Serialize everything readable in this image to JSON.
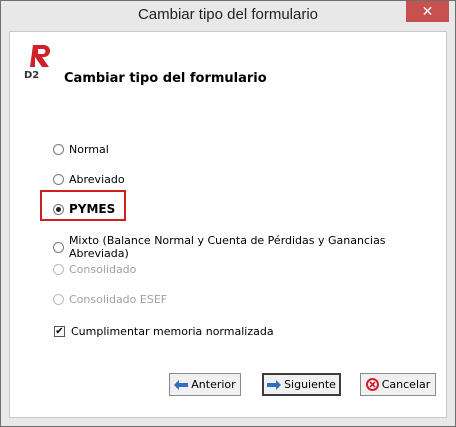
{
  "window": {
    "title": "Cambiar tipo del formulario",
    "close_glyph": "✕"
  },
  "header": {
    "heading": "Cambiar tipo del formulario",
    "logo": "D2"
  },
  "options": [
    {
      "label": "Normal",
      "checked": false,
      "enabled": true
    },
    {
      "label": "Abreviado",
      "checked": false,
      "enabled": true
    },
    {
      "label": "PYMES",
      "checked": true,
      "enabled": true
    },
    {
      "label": "Mixto (Balance Normal y Cuenta de Pérdidas y Ganancias Abreviada)",
      "checked": false,
      "enabled": true
    },
    {
      "label": "Consolidado",
      "checked": false,
      "enabled": false
    },
    {
      "label": "Consolidado ESEF",
      "checked": false,
      "enabled": false
    }
  ],
  "checkbox": {
    "label": "Cumplimentar memoria normalizada",
    "checked": true,
    "mark": "✔"
  },
  "buttons": {
    "back_label": "Anterior",
    "next_label": "Siguiente",
    "cancel_label": "Cancelar"
  },
  "colors": {
    "highlight": "#d01f1f",
    "close_bg": "#c75050",
    "logo_red": "#d0202a",
    "arrow_blue": "#2f6fc2"
  }
}
